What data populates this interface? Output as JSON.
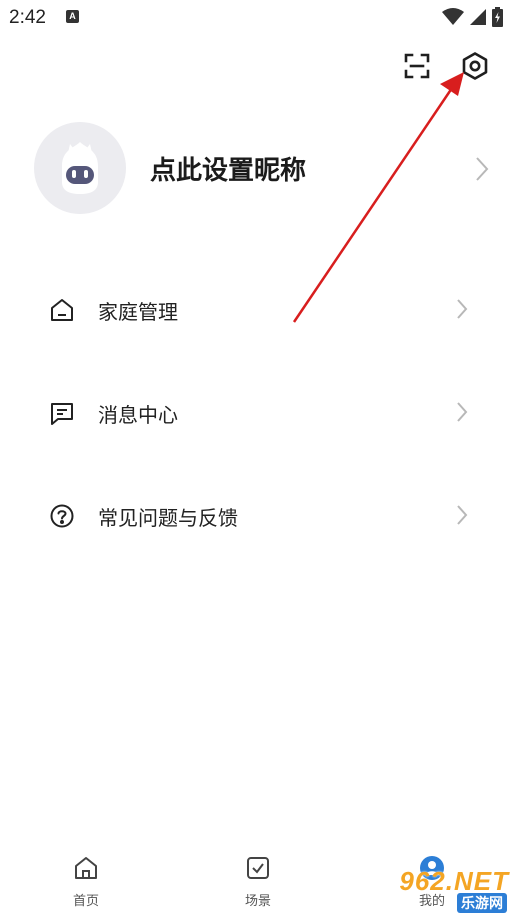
{
  "status_bar": {
    "time": "2:42",
    "notification_glyph": "A",
    "icons": [
      "wifi-icon",
      "signal-icon",
      "battery-charging-icon"
    ]
  },
  "toolbar": {
    "icons": [
      "scan-icon",
      "settings-icon"
    ]
  },
  "profile": {
    "nickname": "点此设置昵称",
    "avatar": "robot-avatar"
  },
  "menu": [
    {
      "label": "家庭管理",
      "icon": "home-icon"
    },
    {
      "label": "消息中心",
      "icon": "message-icon"
    },
    {
      "label": "常见问题与反馈",
      "icon": "help-icon"
    }
  ],
  "tabbar": [
    {
      "label": "首页",
      "icon": "home-tab-icon"
    },
    {
      "label": "场景",
      "icon": "scene-tab-icon"
    },
    {
      "label": "我的",
      "icon": "profile-tab-icon"
    }
  ],
  "watermark": {
    "main": "962.NET",
    "sub": "乐游网"
  },
  "colors": {
    "annotation_arrow": "#d81e1e",
    "watermark_orange": "#f4a524",
    "watermark_blue": "#2c7ed6",
    "avatar_bg": "#ececf0"
  }
}
